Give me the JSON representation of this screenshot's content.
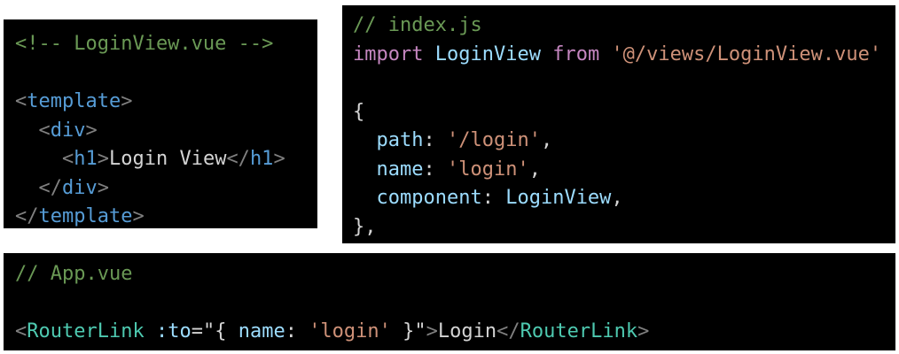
{
  "loginview_panel": {
    "comment": "<!-- LoginView.vue -->",
    "template_open_lt": "<",
    "template_tag": "template",
    "template_open_gt": ">",
    "div_open_lt": "<",
    "div_tag": "div",
    "div_open_gt": ">",
    "h1_open_lt": "<",
    "h1_tag": "h1",
    "h1_open_gt": ">",
    "h1_text": "Login View",
    "h1_close_lt": "</",
    "h1_close_tag": "h1",
    "h1_close_gt": ">",
    "div_close_lt": "</",
    "div_close_tag": "div",
    "div_close_gt": ">",
    "template_close_lt": "</",
    "template_close_tag": "template",
    "template_close_gt": ">"
  },
  "index_panel": {
    "comment": "// index.js",
    "import_kw": "import",
    "import_name": "LoginView",
    "from_kw": "from",
    "import_path": "'@/views/LoginView.vue'",
    "open_brace": "{",
    "path_key": "path",
    "path_colon": ":",
    "path_value": "'/login'",
    "path_comma": ",",
    "name_key": "name",
    "name_colon": ":",
    "name_value": "'login'",
    "name_comma": ",",
    "component_key": "component",
    "component_colon": ":",
    "component_value": "LoginView",
    "component_comma": ",",
    "close_brace": "},"
  },
  "app_panel": {
    "comment": "// App.vue",
    "lt": "<",
    "tag": "RouterLink",
    "attr": ":to",
    "eq": "=",
    "quote_open": "\"",
    "brace_open": "{",
    "obj_key": "name",
    "obj_colon": ":",
    "obj_value": "'login'",
    "brace_close": "}",
    "quote_close": "\"",
    "gt": ">",
    "link_text": "Login",
    "close_lt": "</",
    "close_tag": "RouterLink",
    "close_gt": ">"
  }
}
